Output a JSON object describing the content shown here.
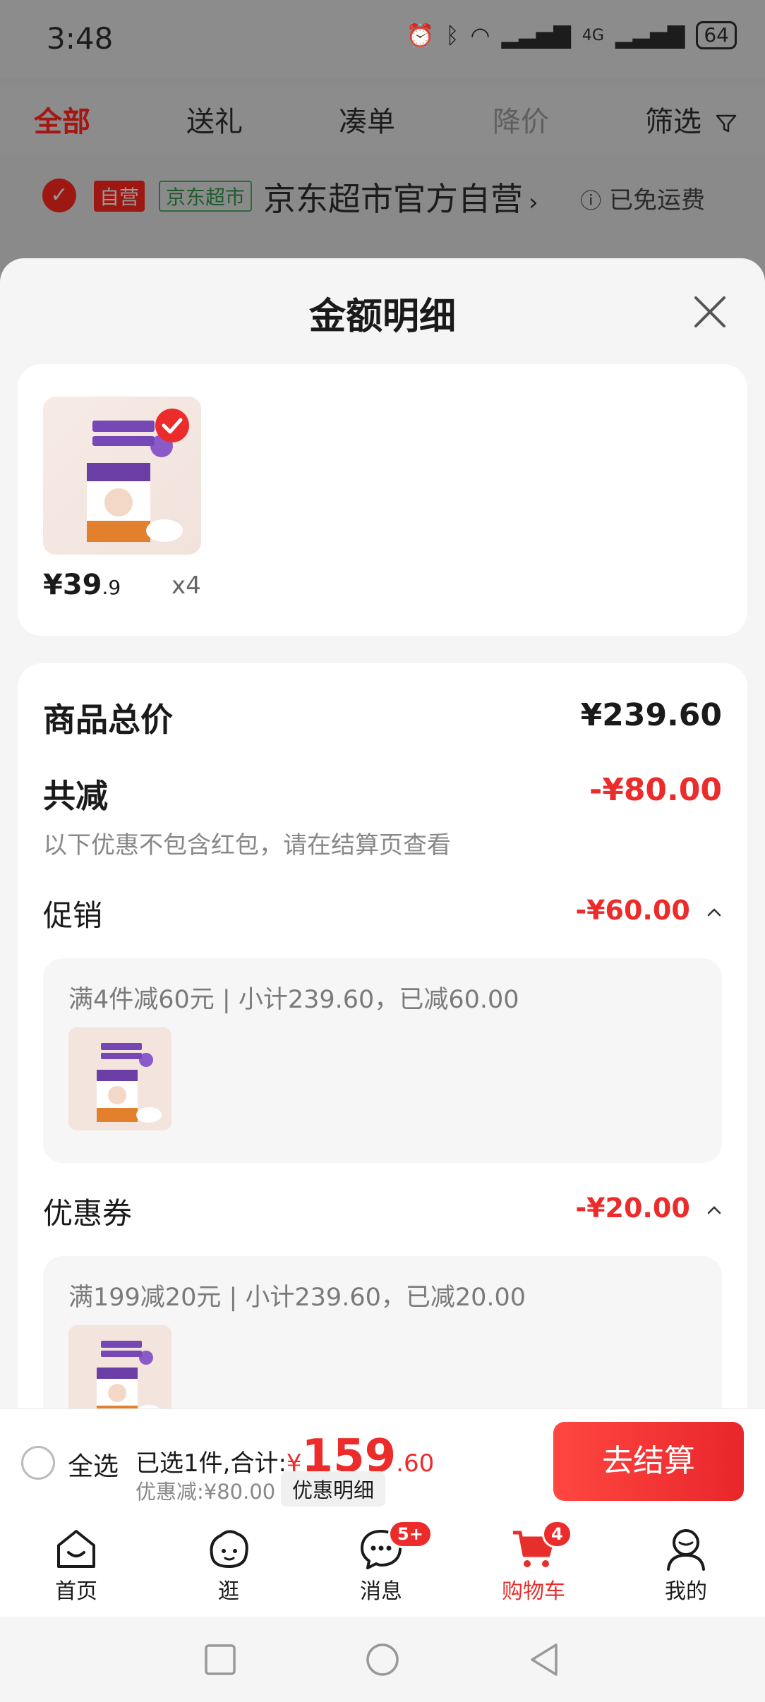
{
  "status_bar": {
    "time": "3:48",
    "battery": "64",
    "network": "4G"
  },
  "filter_tabs": {
    "all": "全部",
    "gift": "送礼",
    "combine": "凑单",
    "price_drop": "降价",
    "filter": "筛选"
  },
  "store": {
    "tag_self": "自营",
    "tag_jd": "京东超市",
    "name": "京东超市官方自营",
    "shipping": "已免运费"
  },
  "sheet": {
    "title": "金额明细",
    "product": {
      "price_int": "¥39",
      "price_dec": ".9",
      "qty": "x4"
    },
    "total_label": "商品总价",
    "total_value": "¥239.60",
    "reduce_label": "共减",
    "reduce_value": "-¥80.00",
    "hint": "以下优惠不包含红包，请在结算页查看",
    "promo": {
      "label": "促销",
      "value": "-¥60.00",
      "box_text": "满4件减60元 | 小计239.60，已减60.00"
    },
    "coupon": {
      "label": "优惠券",
      "value": "-¥20.00",
      "box_text": "满199减20元 | 小计239.60，已减20.00"
    }
  },
  "checkout": {
    "select_all": "全选",
    "selected_prefix": "已选1件,合计:",
    "total_symbol": "¥",
    "total_int": "159",
    "total_dec": ".60",
    "discount": "优惠减:¥80.00",
    "detail_chip": "优惠明细",
    "button": "去结算"
  },
  "nav": {
    "home": "首页",
    "browse": "逛",
    "messages": "消息",
    "messages_badge": "5+",
    "cart": "购物车",
    "cart_badge": "4",
    "me": "我的"
  },
  "colors": {
    "accent_red": "#ec2b2b",
    "sheet_bg": "#f5f5f5",
    "overlay": "#8a8a8a"
  }
}
